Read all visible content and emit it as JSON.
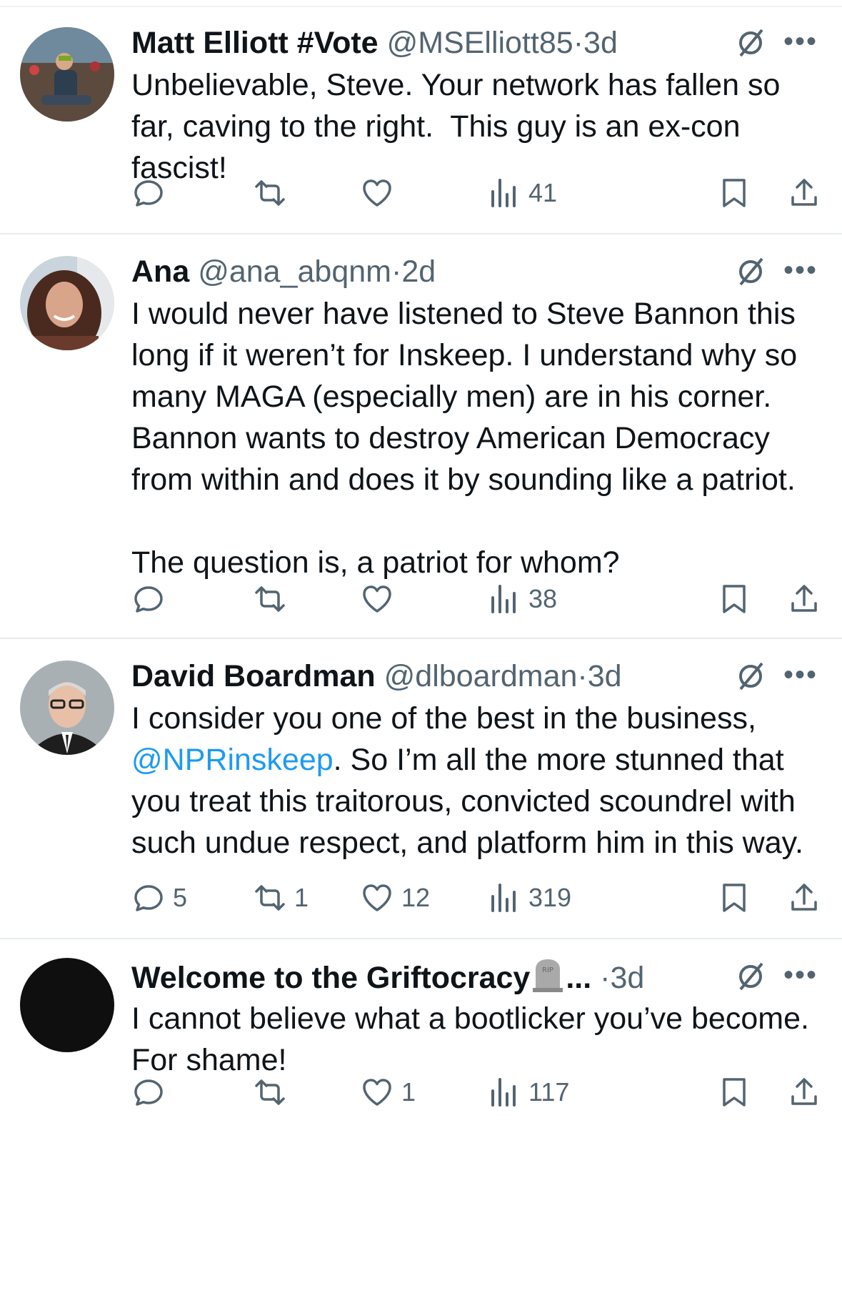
{
  "tweets": [
    {
      "name": "Matt Elliott #Vote",
      "handle": "@MSElliott85",
      "time": "3d",
      "text": "Unbelievable, Steve. Your network has fallen so far, caving to the right.  This guy is an ex-con fascist!",
      "replies": "",
      "retweets": "",
      "likes": "",
      "views": "41"
    },
    {
      "name": "Ana",
      "handle": "@ana_abqnm",
      "time": "2d",
      "text": "I would never have listened to Steve Bannon this long if it weren’t for Inskeep. I understand why so many MAGA (especially men) are in his corner. Bannon wants to destroy American Democracy from within and does it by sounding like a patriot.\n\nThe question is, a patriot for whom?",
      "replies": "",
      "retweets": "",
      "likes": "",
      "views": "38"
    },
    {
      "name": "David Boardman",
      "handle": "@dlboardman",
      "time": "3d",
      "text_before": "I consider you one of the best in the business, ",
      "mention": "@NPRinskeep",
      "text_after": ". So I’m all the more stunned that you treat this traitorous, convicted scoundrel with such undue respect, and platform him in this way.",
      "replies": "5",
      "retweets": "1",
      "likes": "12",
      "views": "319"
    },
    {
      "name": "Welcome to the Griftocracy",
      "name_suffix": "...",
      "handle": "",
      "time": "3d",
      "text": "I cannot believe what a bootlicker you’ve become. For shame!",
      "replies": "",
      "retweets": "",
      "likes": "1",
      "views": "117"
    }
  ],
  "ui": {
    "dot": "·",
    "more": "•••",
    "icons": [
      "grok-icon",
      "more-icon",
      "reply-icon",
      "retweet-icon",
      "like-icon",
      "views-icon",
      "bookmark-icon",
      "share-icon",
      "tombstone-icon"
    ],
    "accent": "#1d9bf0",
    "secondary_text": "#536471"
  }
}
